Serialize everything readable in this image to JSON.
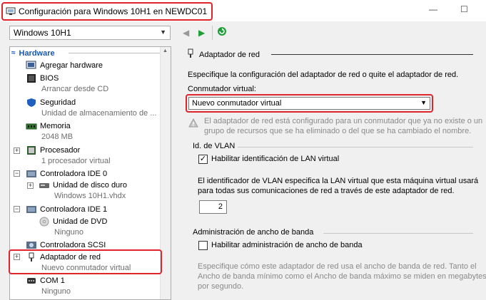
{
  "window": {
    "title": "Configuración para Windows 10H1 en NEWDC01"
  },
  "toolbar": {
    "vm_selected": "Windows 10H1"
  },
  "tree": {
    "header": "Hardware",
    "items": [
      {
        "label": "Agregar hardware",
        "sub": ""
      },
      {
        "label": "BIOS",
        "sub": "Arrancar desde CD"
      },
      {
        "label": "Seguridad",
        "sub": "Unidad de almacenamiento de ..."
      },
      {
        "label": "Memoria",
        "sub": "2048 MB"
      },
      {
        "label": "Procesador",
        "sub": "1 procesador virtual"
      },
      {
        "label": "Controladora IDE 0",
        "sub": ""
      },
      {
        "label": "Unidad de disco duro",
        "sub": "Windows 10H1.vhdx"
      },
      {
        "label": "Controladora IDE 1",
        "sub": ""
      },
      {
        "label": "Unidad de DVD",
        "sub": "Ninguno"
      },
      {
        "label": "Controladora SCSI",
        "sub": ""
      },
      {
        "label": "Adaptador de red",
        "sub": "Nuevo conmutador virtual"
      },
      {
        "label": "COM 1",
        "sub": "Ninguno"
      }
    ]
  },
  "panel": {
    "title": "Adaptador de red",
    "intro": "Especifique la configuración del adaptador de red o quite el adaptador de red.",
    "switch_label": "Conmutador virtual:",
    "switch_value": "Nuevo conmutador virtual",
    "warning_line1": "El adaptador de red está configurado para un conmutador que ya no existe o un",
    "warning_line2": "grupo de recursos que se ha eliminado o del que se ha cambiado el nombre.",
    "vlan_title": "Id. de VLAN",
    "vlan_checkbox": "Habilitar identificación de LAN virtual",
    "vlan_desc_line1": "El identificador de VLAN especifica la LAN virtual que esta máquina virtual usará",
    "vlan_desc_line2": "para todas sus comunicaciones de red a través de este adaptador de red.",
    "vlan_value": "2",
    "bw_title": "Administración de ancho de banda",
    "bw_checkbox": "Habilitar administración de ancho de banda",
    "bw_desc_line1": "Especifique cómo este adaptador de red usa el ancho de banda de red. Tanto el",
    "bw_desc_line2": "Ancho de banda mínimo como el Ancho de banda máximo se miden en megabytes",
    "bw_desc_line3": "por segundo."
  }
}
